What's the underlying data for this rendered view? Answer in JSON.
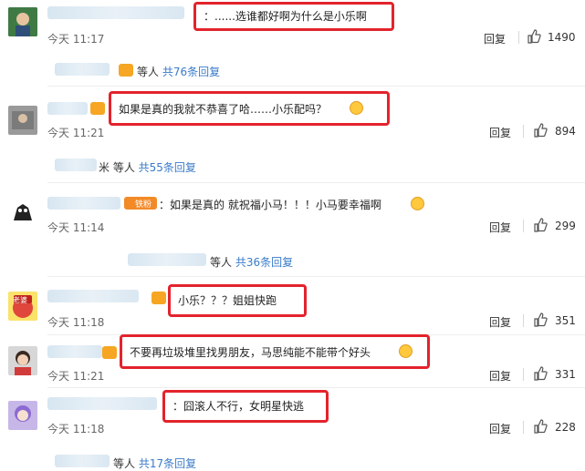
{
  "comments": [
    {
      "text": "：......选谁都好啊为什么是小乐啊",
      "time": "今天 11:17",
      "likes": "1490"
    },
    {
      "text": "如果是真的我就不恭喜了哈……小乐配吗？",
      "time": "今天 11:21",
      "likes": "894"
    },
    {
      "tag": "铁粉",
      "text": "：如果是真的 就祝福小马！！！小马要幸福啊",
      "time": "今天 11:14",
      "likes": "299"
    },
    {
      "text": "小乐？？？姐姐快跑",
      "time": "今天 11:18",
      "likes": "351"
    },
    {
      "text": "不要再垃圾堆里找男朋友，马思纯能不能带个好头",
      "time": "今天 11:21",
      "likes": "331"
    },
    {
      "text": "：囧滚人不行，女明星快逃",
      "time": "今天 11:18",
      "likes": "228"
    }
  ],
  "subreplies": [
    {
      "prefix": "等人",
      "link": "共76条回复"
    },
    {
      "prefix": "米 等人",
      "link": "共55条回复"
    },
    {
      "prefix": "等人",
      "link": "共36条回复"
    },
    {
      "prefix": "等人",
      "link": "共17条回复"
    }
  ],
  "reply_label": "回复",
  "avatar_labels": {
    "a4": "老婆"
  },
  "colors": {
    "highlight_box": "#e3232c",
    "link": "#3a7bc8",
    "badge": "#f6a623"
  }
}
